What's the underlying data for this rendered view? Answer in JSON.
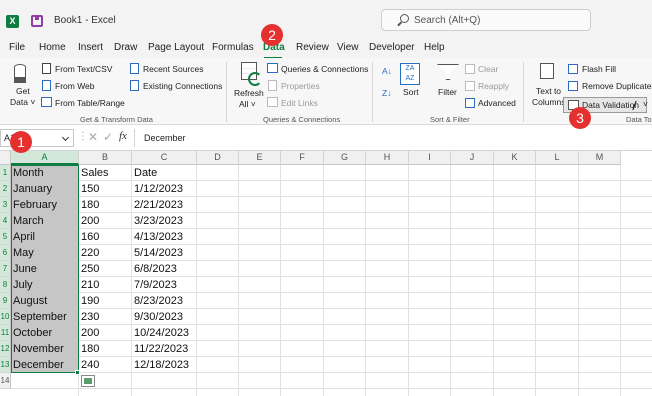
{
  "app": {
    "title": "Book1 - Excel",
    "search_placeholder": "Search (Alt+Q)"
  },
  "menu": {
    "tabs": [
      "File",
      "Home",
      "Insert",
      "Draw",
      "Page Layout",
      "Formulas",
      "Data",
      "Review",
      "View",
      "Developer",
      "Help"
    ],
    "active_tab": "Data"
  },
  "ribbon": {
    "get_data": {
      "line1": "Get",
      "line2": "Data ˅"
    },
    "from_text_csv": "From Text/CSV",
    "from_web": "From Web",
    "from_table_range": "From Table/Range",
    "recent_sources": "Recent Sources",
    "existing_connections": "Existing Connections",
    "group_get_transform": "Get & Transform Data",
    "refresh_all": {
      "line1": "Refresh",
      "line2": "All ˅"
    },
    "queries_connections": "Queries & Connections",
    "properties": "Properties",
    "edit_links": "Edit Links",
    "group_queries": "Queries & Connections",
    "sort": "Sort",
    "filter": "Filter",
    "clear": "Clear",
    "reapply": "Reapply",
    "advanced": "Advanced",
    "group_sort_filter": "Sort & Filter",
    "text_to_columns": {
      "line1": "Text to",
      "line2": "Columns"
    },
    "flash_fill": "Flash Fill",
    "remove_duplicates": "Remove Duplicates",
    "data_validation": "Data Validation",
    "data_validation_dd": "˅",
    "group_data_tools": "Data Too"
  },
  "badges": [
    "1",
    "2",
    "3"
  ],
  "formula_bar": {
    "name_box": "A1",
    "separator": "⋮",
    "cancel": "✕",
    "enter": "✓",
    "fx": "fx",
    "content": "December"
  },
  "grid": {
    "columns": [
      "A",
      "B",
      "C",
      "D",
      "E",
      "F",
      "G",
      "H",
      "I",
      "J",
      "K",
      "L",
      "M"
    ],
    "rows": [
      "1",
      "2",
      "3",
      "4",
      "5",
      "6",
      "7",
      "8",
      "9",
      "10",
      "11",
      "12",
      "13",
      "14"
    ],
    "cells": [
      [
        "Month",
        "Sales",
        "Date"
      ],
      [
        "January",
        "150",
        "1/12/2023"
      ],
      [
        "February",
        "180",
        "2/21/2023"
      ],
      [
        "March",
        "200",
        "3/23/2023"
      ],
      [
        "April",
        "160",
        "4/13/2023"
      ],
      [
        "May",
        "220",
        "5/14/2023"
      ],
      [
        "June",
        "250",
        "6/8/2023"
      ],
      [
        "July",
        "210",
        "7/9/2023"
      ],
      [
        "August",
        "190",
        "8/23/2023"
      ],
      [
        "September",
        "230",
        "9/30/2023"
      ],
      [
        "October",
        "200",
        "10/24/2023"
      ],
      [
        "November",
        "180",
        "11/22/2023"
      ],
      [
        "December",
        "240",
        "12/18/2023"
      ]
    ]
  },
  "colors": {
    "excel_green": "#107c41",
    "badge_red": "#e53030",
    "selection_fill": "#c6c6c6"
  }
}
